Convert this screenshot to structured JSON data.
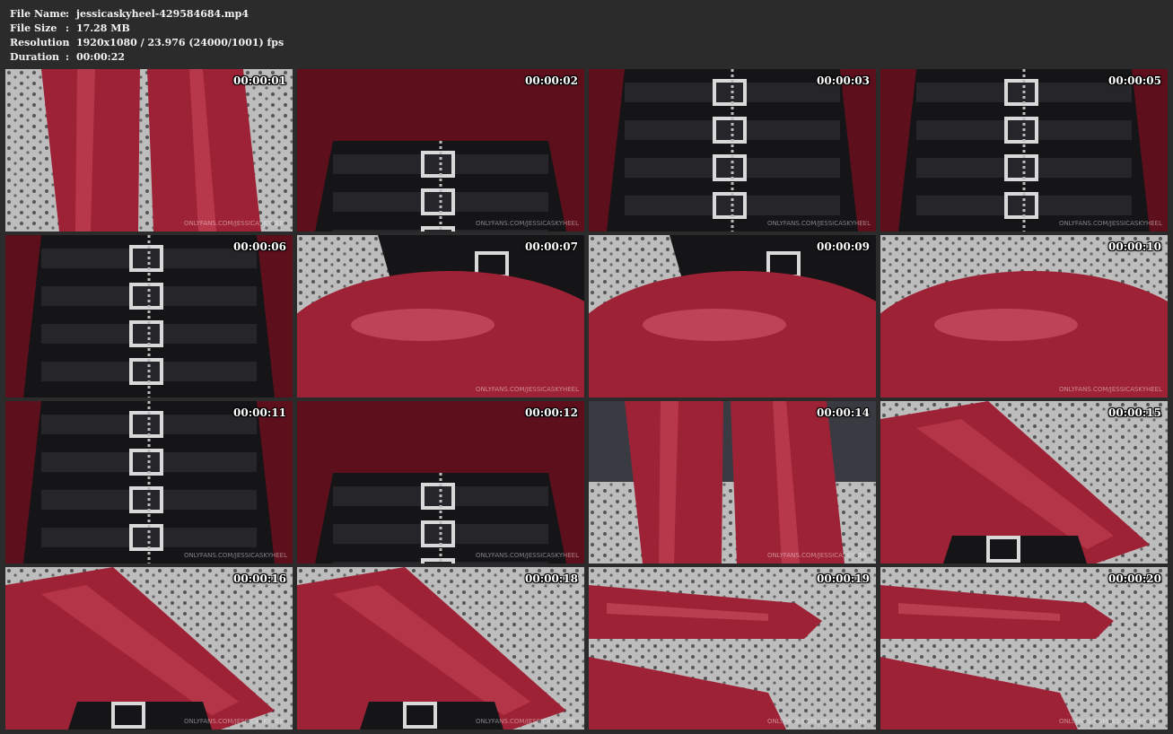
{
  "file_info": {
    "file_name": {
      "label": "File Name",
      "value": "jessicaskyheel-429584684.mp4"
    },
    "file_size": {
      "label": "File Size",
      "value": "17.28 MB"
    },
    "resolution": {
      "label": "Resolution",
      "value": "1920x1080 / 23.976 (24000/1001) fps"
    },
    "duration": {
      "label": "Duration",
      "value": "00:00:22"
    },
    "separator": ":"
  },
  "thumbnails": [
    {
      "timestamp": "00:00:01",
      "scene": "legs",
      "watermark": "ONLYFANS.COM/JESSICASKYHEEL"
    },
    {
      "timestamp": "00:00:02",
      "scene": "corset-low",
      "watermark": "ONLYFANS.COM/JESSICASKYHEEL"
    },
    {
      "timestamp": "00:00:03",
      "scene": "corset",
      "watermark": "ONLYFANS.COM/JESSICASKYHEEL"
    },
    {
      "timestamp": "00:00:05",
      "scene": "corset",
      "watermark": "ONLYFANS.COM/JESSICASKYHEEL"
    },
    {
      "timestamp": "00:00:06",
      "scene": "corset-tilt",
      "watermark": ""
    },
    {
      "timestamp": "00:00:07",
      "scene": "hip-corset",
      "watermark": "ONLYFANS.COM/JESSICASKYHEEL"
    },
    {
      "timestamp": "00:00:09",
      "scene": "hip-corset",
      "watermark": ""
    },
    {
      "timestamp": "00:00:10",
      "scene": "hip",
      "watermark": "ONLYFANS.COM/JESSICASKYHEEL"
    },
    {
      "timestamp": "00:00:11",
      "scene": "corset",
      "watermark": "ONLYFANS.COM/JESSICASKYHEEL"
    },
    {
      "timestamp": "00:00:12",
      "scene": "corset-low",
      "watermark": "ONLYFANS.COM/JESSICASKYHEEL"
    },
    {
      "timestamp": "00:00:14",
      "scene": "legs-room",
      "watermark": "ONLYFANS.COM/JESSICASKYHEEL"
    },
    {
      "timestamp": "00:00:15",
      "scene": "legs-diag",
      "watermark": ""
    },
    {
      "timestamp": "00:00:16",
      "scene": "legs-diag",
      "watermark": "ONLYFANS.COM/JESSICASKYHEEL"
    },
    {
      "timestamp": "00:00:18",
      "scene": "legs-diag",
      "watermark": "ONLYFANS.COM/JESSICASKYHEEL"
    },
    {
      "timestamp": "00:00:19",
      "scene": "feet",
      "watermark": "ONLYFANS.COM/JESSICASKYHEEL"
    },
    {
      "timestamp": "00:00:20",
      "scene": "feet",
      "watermark": "ONLYFANS.COM/JESSICASKYHEEL"
    }
  ],
  "colors": {
    "background": "#2b2b2b",
    "latex_red": "#9e2235",
    "latex_dark": "#5e0f1c",
    "latex_black": "#151517",
    "fabric": "#bdbdbd"
  }
}
